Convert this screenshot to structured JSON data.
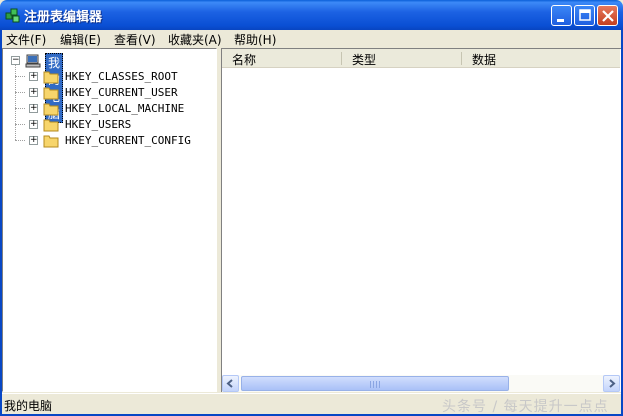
{
  "window": {
    "title": "注册表编辑器",
    "title_icon": "registry-editor-icon",
    "buttons": [
      "minimize-icon",
      "maximize-icon",
      "close-icon"
    ]
  },
  "menu": [
    {
      "label": "文件(F)"
    },
    {
      "label": "编辑(E)"
    },
    {
      "label": "查看(V)"
    },
    {
      "label": "收藏夹(A)"
    },
    {
      "label": "帮助(H)"
    }
  ],
  "tree": {
    "root": {
      "label": "我的电脑",
      "icon": "computer-icon"
    },
    "keys": [
      {
        "label": "HKEY_CLASSES_ROOT"
      },
      {
        "label": "HKEY_CURRENT_USER"
      },
      {
        "label": "HKEY_LOCAL_MACHINE"
      },
      {
        "label": "HKEY_USERS"
      },
      {
        "label": "HKEY_CURRENT_CONFIG"
      }
    ]
  },
  "list": {
    "columns": [
      {
        "label": "名称"
      },
      {
        "label": "类型"
      },
      {
        "label": "数据"
      }
    ]
  },
  "status": {
    "text": "我的电脑"
  },
  "watermark": "头条号 / 每天提升一点点",
  "colors": {
    "selection": "#316ac5",
    "titlebar": "#0a4fd4",
    "chrome": "#ece9d8"
  }
}
